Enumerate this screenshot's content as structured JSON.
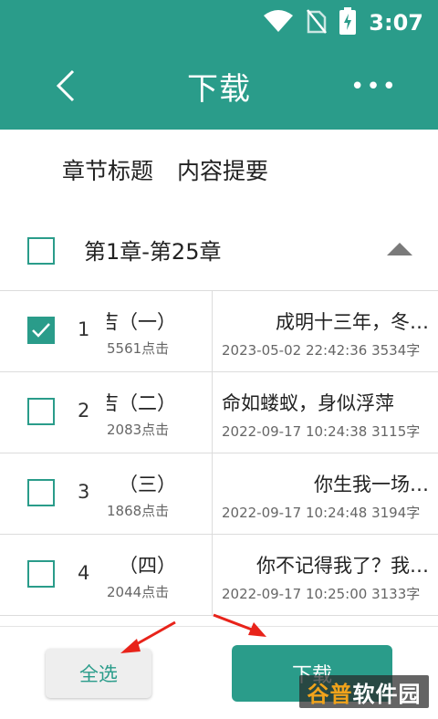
{
  "status_bar": {
    "time": "3:07",
    "icons": [
      "wifi-icon",
      "no-sim-icon",
      "battery-charging-icon"
    ]
  },
  "header": {
    "title": "下载",
    "back_icon": "chevron-left-icon",
    "more_icon": "more-dots-icon",
    "more_label": "•••"
  },
  "tabs": [
    {
      "label": "章节标题"
    },
    {
      "label": "内容提要"
    }
  ],
  "group": {
    "title": "第1章-第25章",
    "checked": false,
    "expanded": true
  },
  "chapters": [
    {
      "index": "1",
      "title": "吉（一）",
      "clicks": "5561点击",
      "summary": "成明十三年，冬…",
      "date": "2023-05-02 22:42:36",
      "words": "3534字",
      "checked": true
    },
    {
      "index": "2",
      "title": "吉（二）",
      "clicks": "2083点击",
      "summary": "命如蝼蚁，身似浮萍",
      "date": "2022-09-17 10:24:38",
      "words": "3115字",
      "checked": false
    },
    {
      "index": "3",
      "title": "（三）",
      "clicks": "1868点击",
      "summary": "你生我一场…",
      "date": "2022-09-17 10:24:48",
      "words": "3194字",
      "checked": false
    },
    {
      "index": "4",
      "title": "（四）",
      "clicks": "2044点击",
      "summary": "你不记得我了？我…",
      "date": "2022-09-17 10:25:00",
      "words": "3133字",
      "checked": false
    }
  ],
  "bottom": {
    "select_all_label": "全选",
    "download_label": "下载"
  },
  "watermark": {
    "part1": "谷普",
    "part2": "软件园"
  },
  "colors": {
    "primary": "#2a9c8a",
    "annotation_arrow": "#e8231a"
  }
}
